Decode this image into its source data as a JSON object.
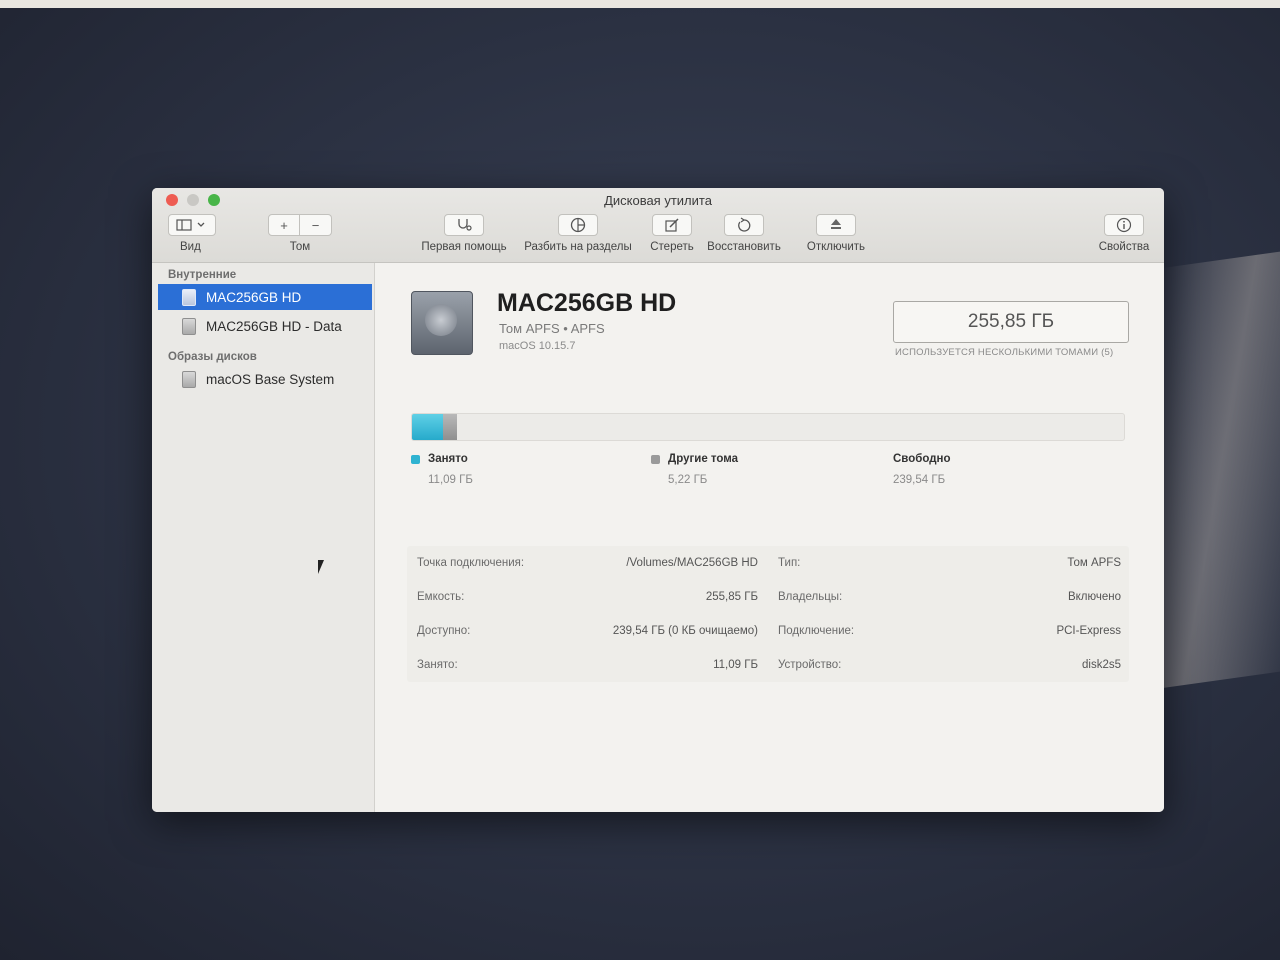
{
  "window": {
    "title": "Дисковая утилита"
  },
  "toolbar": {
    "view_label": "Вид",
    "volume_label": "Том",
    "volume_add": "+",
    "volume_remove": "−",
    "first_aid_label": "Первая помощь",
    "partition_label": "Разбить на разделы",
    "erase_label": "Стереть",
    "restore_label": "Восстановить",
    "unmount_label": "Отключить",
    "info_label": "Свойства"
  },
  "sidebar": {
    "internal_header": "Внутренние",
    "internal_items": [
      {
        "label": "MAC256GB HD",
        "selected": true
      },
      {
        "label": "MAC256GB HD - Data",
        "selected": false
      }
    ],
    "images_header": "Образы дисков",
    "image_items": [
      {
        "label": "macOS Base System"
      }
    ]
  },
  "volume": {
    "name": "MAC256GB HD",
    "subtitle": "Том APFS • APFS",
    "os": "macOS 10.15.7",
    "capacity": "255,85 ГБ",
    "capacity_note": "ИСПОЛЬЗУЕТСЯ НЕСКОЛЬКИМИ ТОМАМИ (5)"
  },
  "usage": {
    "used_fraction": 0.0433,
    "other_fraction": 0.0204,
    "used": {
      "label": "Занято",
      "value": "11,09 ГБ",
      "color": "#2fb3d1"
    },
    "other": {
      "label": "Другие тома",
      "value": "5,22 ГБ",
      "color": "#9a9a9a"
    },
    "free": {
      "label": "Свободно",
      "value": "239,54 ГБ"
    }
  },
  "info": {
    "left": [
      {
        "key": "Точка подключения:",
        "value": "/Volumes/MAC256GB HD"
      },
      {
        "key": "Емкость:",
        "value": "255,85 ГБ"
      },
      {
        "key": "Доступно:",
        "value": "239,54 ГБ (0 КБ очищаемо)"
      },
      {
        "key": "Занято:",
        "value": "11,09 ГБ"
      }
    ],
    "right": [
      {
        "key": "Тип:",
        "value": "Том APFS"
      },
      {
        "key": "Владельцы:",
        "value": "Включено"
      },
      {
        "key": "Подключение:",
        "value": "PCI-Express"
      },
      {
        "key": "Устройство:",
        "value": "disk2s5"
      }
    ]
  }
}
